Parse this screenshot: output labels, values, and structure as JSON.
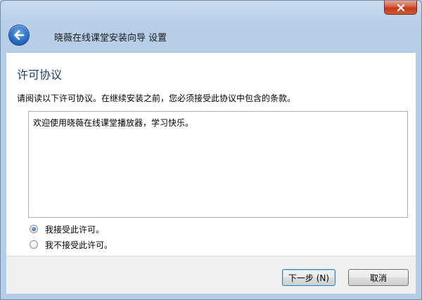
{
  "window": {
    "title": "晓薇在线课堂安装向导 设置"
  },
  "icons": {
    "close": "close-icon",
    "back": "back-arrow-icon"
  },
  "page": {
    "section_title": "许可协议",
    "instruction": "请阅读以下许可协议。在继续安装之前，您必须接受此协议中包含的条款。",
    "license_text": "欢迎使用晓薇在线课堂播放器，学习快乐。"
  },
  "options": {
    "accept_label": "我接受此许可。",
    "decline_label": "我不接受此许可。",
    "selected": "accept"
  },
  "footer": {
    "next_label": "下一步 (N)",
    "cancel_label": "取消"
  },
  "colors": {
    "accent": "#2a6fc9",
    "close_red": "#c2381a",
    "title_blue": "#1e3b6b"
  }
}
